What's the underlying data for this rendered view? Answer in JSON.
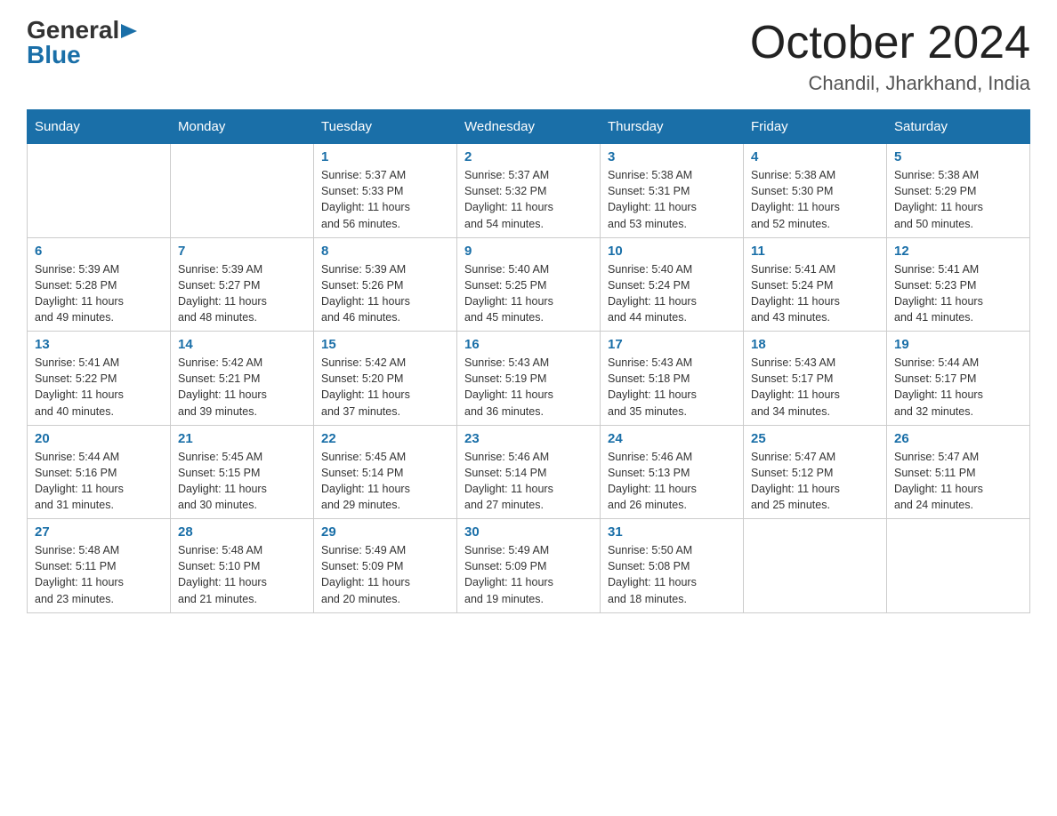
{
  "header": {
    "logo_general": "General",
    "logo_arrow": "▶",
    "logo_blue": "Blue",
    "month_title": "October 2024",
    "location": "Chandil, Jharkhand, India"
  },
  "weekdays": [
    "Sunday",
    "Monday",
    "Tuesday",
    "Wednesday",
    "Thursday",
    "Friday",
    "Saturday"
  ],
  "weeks": [
    [
      {
        "day": "",
        "info": ""
      },
      {
        "day": "",
        "info": ""
      },
      {
        "day": "1",
        "info": "Sunrise: 5:37 AM\nSunset: 5:33 PM\nDaylight: 11 hours\nand 56 minutes."
      },
      {
        "day": "2",
        "info": "Sunrise: 5:37 AM\nSunset: 5:32 PM\nDaylight: 11 hours\nand 54 minutes."
      },
      {
        "day": "3",
        "info": "Sunrise: 5:38 AM\nSunset: 5:31 PM\nDaylight: 11 hours\nand 53 minutes."
      },
      {
        "day": "4",
        "info": "Sunrise: 5:38 AM\nSunset: 5:30 PM\nDaylight: 11 hours\nand 52 minutes."
      },
      {
        "day": "5",
        "info": "Sunrise: 5:38 AM\nSunset: 5:29 PM\nDaylight: 11 hours\nand 50 minutes."
      }
    ],
    [
      {
        "day": "6",
        "info": "Sunrise: 5:39 AM\nSunset: 5:28 PM\nDaylight: 11 hours\nand 49 minutes."
      },
      {
        "day": "7",
        "info": "Sunrise: 5:39 AM\nSunset: 5:27 PM\nDaylight: 11 hours\nand 48 minutes."
      },
      {
        "day": "8",
        "info": "Sunrise: 5:39 AM\nSunset: 5:26 PM\nDaylight: 11 hours\nand 46 minutes."
      },
      {
        "day": "9",
        "info": "Sunrise: 5:40 AM\nSunset: 5:25 PM\nDaylight: 11 hours\nand 45 minutes."
      },
      {
        "day": "10",
        "info": "Sunrise: 5:40 AM\nSunset: 5:24 PM\nDaylight: 11 hours\nand 44 minutes."
      },
      {
        "day": "11",
        "info": "Sunrise: 5:41 AM\nSunset: 5:24 PM\nDaylight: 11 hours\nand 43 minutes."
      },
      {
        "day": "12",
        "info": "Sunrise: 5:41 AM\nSunset: 5:23 PM\nDaylight: 11 hours\nand 41 minutes."
      }
    ],
    [
      {
        "day": "13",
        "info": "Sunrise: 5:41 AM\nSunset: 5:22 PM\nDaylight: 11 hours\nand 40 minutes."
      },
      {
        "day": "14",
        "info": "Sunrise: 5:42 AM\nSunset: 5:21 PM\nDaylight: 11 hours\nand 39 minutes."
      },
      {
        "day": "15",
        "info": "Sunrise: 5:42 AM\nSunset: 5:20 PM\nDaylight: 11 hours\nand 37 minutes."
      },
      {
        "day": "16",
        "info": "Sunrise: 5:43 AM\nSunset: 5:19 PM\nDaylight: 11 hours\nand 36 minutes."
      },
      {
        "day": "17",
        "info": "Sunrise: 5:43 AM\nSunset: 5:18 PM\nDaylight: 11 hours\nand 35 minutes."
      },
      {
        "day": "18",
        "info": "Sunrise: 5:43 AM\nSunset: 5:17 PM\nDaylight: 11 hours\nand 34 minutes."
      },
      {
        "day": "19",
        "info": "Sunrise: 5:44 AM\nSunset: 5:17 PM\nDaylight: 11 hours\nand 32 minutes."
      }
    ],
    [
      {
        "day": "20",
        "info": "Sunrise: 5:44 AM\nSunset: 5:16 PM\nDaylight: 11 hours\nand 31 minutes."
      },
      {
        "day": "21",
        "info": "Sunrise: 5:45 AM\nSunset: 5:15 PM\nDaylight: 11 hours\nand 30 minutes."
      },
      {
        "day": "22",
        "info": "Sunrise: 5:45 AM\nSunset: 5:14 PM\nDaylight: 11 hours\nand 29 minutes."
      },
      {
        "day": "23",
        "info": "Sunrise: 5:46 AM\nSunset: 5:14 PM\nDaylight: 11 hours\nand 27 minutes."
      },
      {
        "day": "24",
        "info": "Sunrise: 5:46 AM\nSunset: 5:13 PM\nDaylight: 11 hours\nand 26 minutes."
      },
      {
        "day": "25",
        "info": "Sunrise: 5:47 AM\nSunset: 5:12 PM\nDaylight: 11 hours\nand 25 minutes."
      },
      {
        "day": "26",
        "info": "Sunrise: 5:47 AM\nSunset: 5:11 PM\nDaylight: 11 hours\nand 24 minutes."
      }
    ],
    [
      {
        "day": "27",
        "info": "Sunrise: 5:48 AM\nSunset: 5:11 PM\nDaylight: 11 hours\nand 23 minutes."
      },
      {
        "day": "28",
        "info": "Sunrise: 5:48 AM\nSunset: 5:10 PM\nDaylight: 11 hours\nand 21 minutes."
      },
      {
        "day": "29",
        "info": "Sunrise: 5:49 AM\nSunset: 5:09 PM\nDaylight: 11 hours\nand 20 minutes."
      },
      {
        "day": "30",
        "info": "Sunrise: 5:49 AM\nSunset: 5:09 PM\nDaylight: 11 hours\nand 19 minutes."
      },
      {
        "day": "31",
        "info": "Sunrise: 5:50 AM\nSunset: 5:08 PM\nDaylight: 11 hours\nand 18 minutes."
      },
      {
        "day": "",
        "info": ""
      },
      {
        "day": "",
        "info": ""
      }
    ]
  ]
}
